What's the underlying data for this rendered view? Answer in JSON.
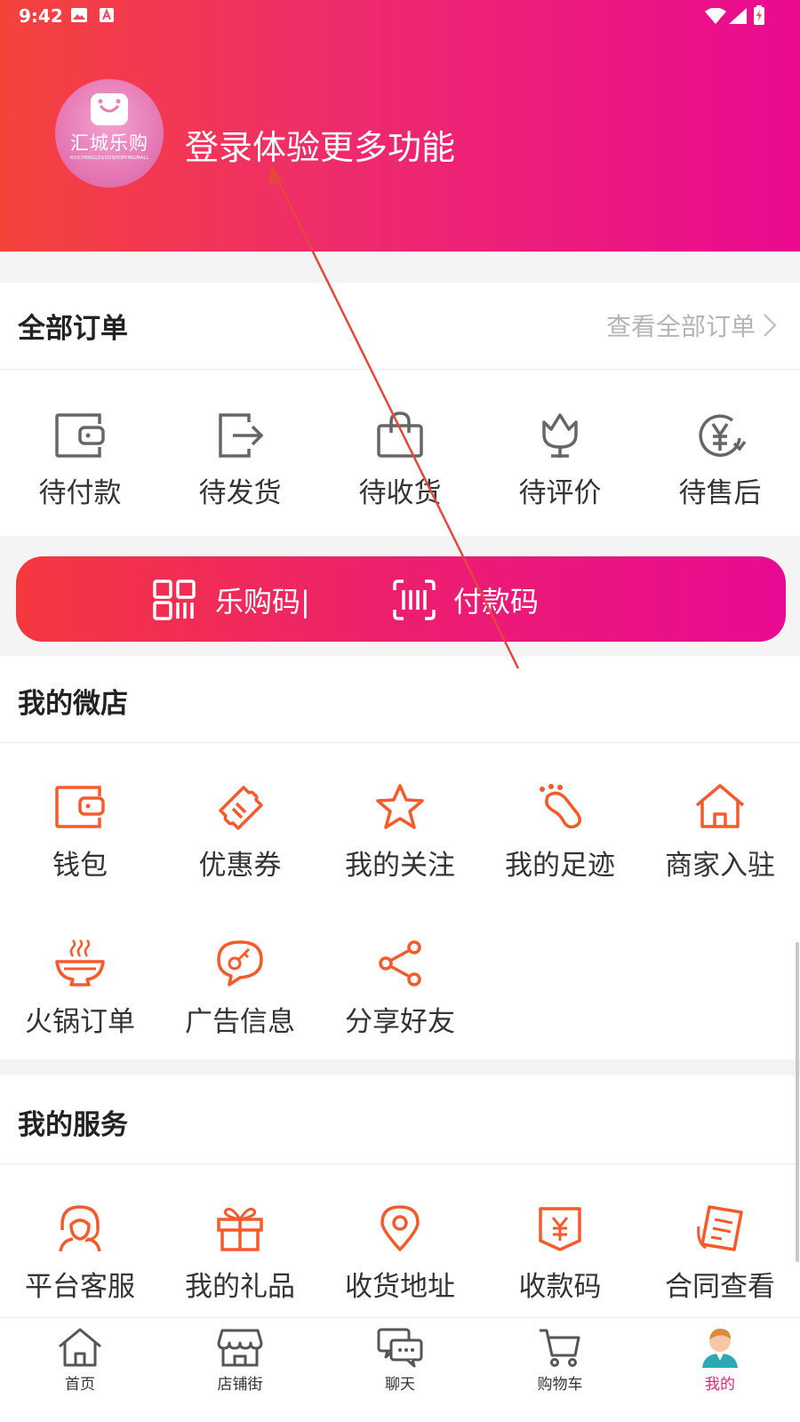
{
  "status": {
    "time": "9:42"
  },
  "profile": {
    "avatar_brand": "汇城乐购",
    "avatar_sub": "HUICHENGLEGOUSHOPPINGMALL",
    "login_text": "登录体验更多功能"
  },
  "orders": {
    "title": "全部订单",
    "view_all": "查看全部订单",
    "items": [
      {
        "label": "待付款",
        "icon": "wallet-icon"
      },
      {
        "label": "待发货",
        "icon": "ship-icon"
      },
      {
        "label": "待收货",
        "icon": "bag-icon"
      },
      {
        "label": "待评价",
        "icon": "flower-icon"
      },
      {
        "label": "待售后",
        "icon": "refund-icon"
      }
    ]
  },
  "paybar": {
    "legou_code": "乐购码|",
    "pay_code": "付款码"
  },
  "shop": {
    "title": "我的微店",
    "items": [
      {
        "label": "钱包",
        "icon": "wallet-icon"
      },
      {
        "label": "优惠券",
        "icon": "coupon-icon"
      },
      {
        "label": "我的关注",
        "icon": "star-icon"
      },
      {
        "label": "我的足迹",
        "icon": "footprint-icon"
      },
      {
        "label": "商家入驻",
        "icon": "home-icon"
      },
      {
        "label": "火锅订单",
        "icon": "hotpot-icon"
      },
      {
        "label": "广告信息",
        "icon": "ad-icon"
      },
      {
        "label": "分享好友",
        "icon": "share-icon"
      }
    ]
  },
  "service": {
    "title": "我的服务",
    "items": [
      {
        "label": "平台客服",
        "icon": "headset-icon"
      },
      {
        "label": "我的礼品",
        "icon": "gift-icon"
      },
      {
        "label": "收货地址",
        "icon": "location-icon"
      },
      {
        "label": "收款码",
        "icon": "receipt-icon"
      },
      {
        "label": "合同查看",
        "icon": "contract-icon"
      }
    ]
  },
  "nav": {
    "items": [
      {
        "label": "首页",
        "icon": "home-icon"
      },
      {
        "label": "店铺街",
        "icon": "store-icon"
      },
      {
        "label": "聊天",
        "icon": "chat-icon"
      },
      {
        "label": "购物车",
        "icon": "cart-icon"
      },
      {
        "label": "我的",
        "icon": "profile-icon"
      }
    ]
  },
  "colors": {
    "accent": "#f45a2a",
    "brand_start": "#f5433c",
    "brand_end": "#ea0a90",
    "nav_active": "#e9207a"
  }
}
